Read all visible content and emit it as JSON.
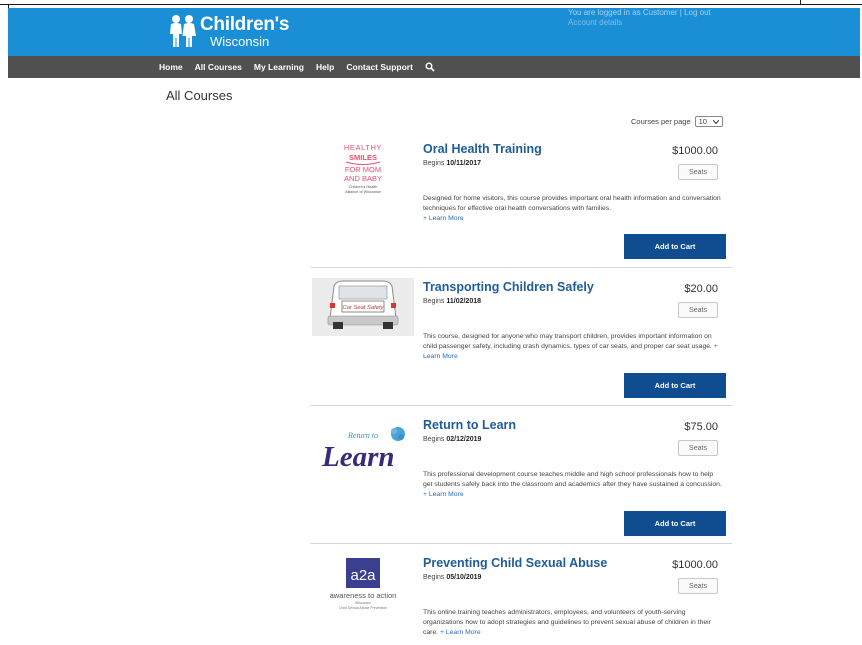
{
  "header": {
    "brand_line1": "Children's",
    "brand_line2": "Wisconsin",
    "status_text": "You are logged in as Customer | Log out",
    "status_sub": "Account details"
  },
  "nav": {
    "items": [
      "Home",
      "All Courses",
      "My Learning",
      "Help",
      "Contact Support"
    ],
    "search_icon": "search-icon"
  },
  "page": {
    "title": "All Courses",
    "per_page_label": "Courses per page",
    "per_page_value": "10"
  },
  "courses": [
    {
      "title": "Oral Health Training",
      "begins_label": "Begins",
      "begins_date": "10/11/2017",
      "price": "$1000.00",
      "seats_label": "Seats",
      "description": "Designed for home visitors, this course provides important oral health information and conversation techniques for effective oral health conversations with families.",
      "learn_more": "+ Learn More",
      "cart_label": "Add to Cart",
      "image": {
        "line1": "HEALTHY",
        "line2": "SMILES",
        "line3": "FOR MOM",
        "line4": "AND BABY",
        "line5": "Children's Health",
        "line6": "Alliance of Wisconsin"
      }
    },
    {
      "title": "Transporting Children Safely",
      "begins_label": "Begins",
      "begins_date": "11/02/2018",
      "price": "$20.00",
      "seats_label": "Seats",
      "description": "This course, designed for anyone who may transport children, provides important information on child passenger safety, including crash dynamics, types of car seats, and proper car seat usage.",
      "learn_more": "+ Learn More",
      "cart_label": "Add to Cart",
      "image": {
        "plate": "Car Seat Safety"
      }
    },
    {
      "title": "Return to Learn",
      "begins_label": "Begins",
      "begins_date": "02/12/2019",
      "price": "$75.00",
      "seats_label": "Seats",
      "description": "This professional development course teaches middle and high school professionals how to help get students safely back into the classroom and academics after they have sustained a concussion.",
      "learn_more": "+ Learn More",
      "cart_label": "Add to Cart",
      "image": {
        "small": "Return to",
        "big": "Learn"
      }
    },
    {
      "title": "Preventing Child Sexual Abuse",
      "begins_label": "Begins",
      "begins_date": "05/10/2019",
      "price": "$1000.00",
      "seats_label": "Seats",
      "description": "This online training teaches administrators, employees, and volunteers of youth-serving organizations how to adopt strategies and guidelines to prevent sexual abuse of children in their care.",
      "learn_more": "+ Learn More",
      "cart_label": "Add to Cart",
      "image": {
        "mark": "a2a",
        "tagline": "awareness to action",
        "sub1": "Wisconsin",
        "sub2": "Child Sexual Abuse Prevention"
      }
    }
  ],
  "colors": {
    "header_blue": "#1a8fd6",
    "nav_gray": "#505050",
    "title_blue": "#1f5c99",
    "cart_blue": "#0f4c90",
    "link_blue": "#2a6cb8",
    "healthy_pink": "#e8506e",
    "learn_purple": "#3a2a7a",
    "a2a_purple": "#3b3f8f"
  }
}
